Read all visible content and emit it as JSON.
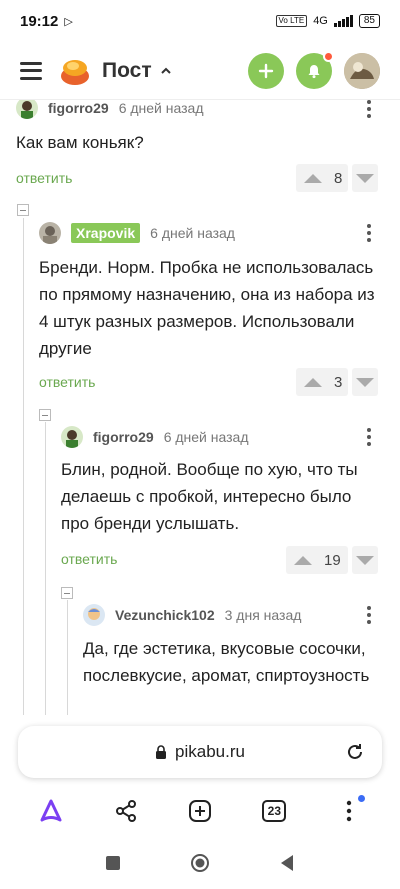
{
  "status_bar": {
    "time": "19:12",
    "network": "4G",
    "volte": "Vo LTE",
    "battery": "85"
  },
  "header": {
    "title": "Пост",
    "add_icon": "plus-icon",
    "notification_icon": "bell-icon",
    "accent_color": "#8ac858"
  },
  "comments": [
    {
      "user": "figorro29",
      "time": "6 дней назад",
      "text": "Как вам коньяк?",
      "reply_label": "ответить",
      "rating": "8"
    },
    {
      "user": "Xrapovik",
      "time": "6 дней назад",
      "text": "Бренди. Норм. Пробка не использовалась по прямому назначению, она из набора из 4 штук разных размеров. Использовали другие",
      "reply_label": "ответить",
      "rating": "3"
    },
    {
      "user": "figorro29",
      "time": "6 дней назад",
      "text": "Блин, родной. Вообще по хую, что ты делаешь с пробкой, интересно было про бренди услышать.",
      "reply_label": "ответить",
      "rating": "19"
    },
    {
      "user": "Vezunchick102",
      "time": "3 дня назад",
      "text": "Да, где эстетика, вкусовые сосочки, послевкусие, аромат, спиртоузность"
    }
  ],
  "browser": {
    "url": "pikabu.ru",
    "tab_count": "23"
  }
}
